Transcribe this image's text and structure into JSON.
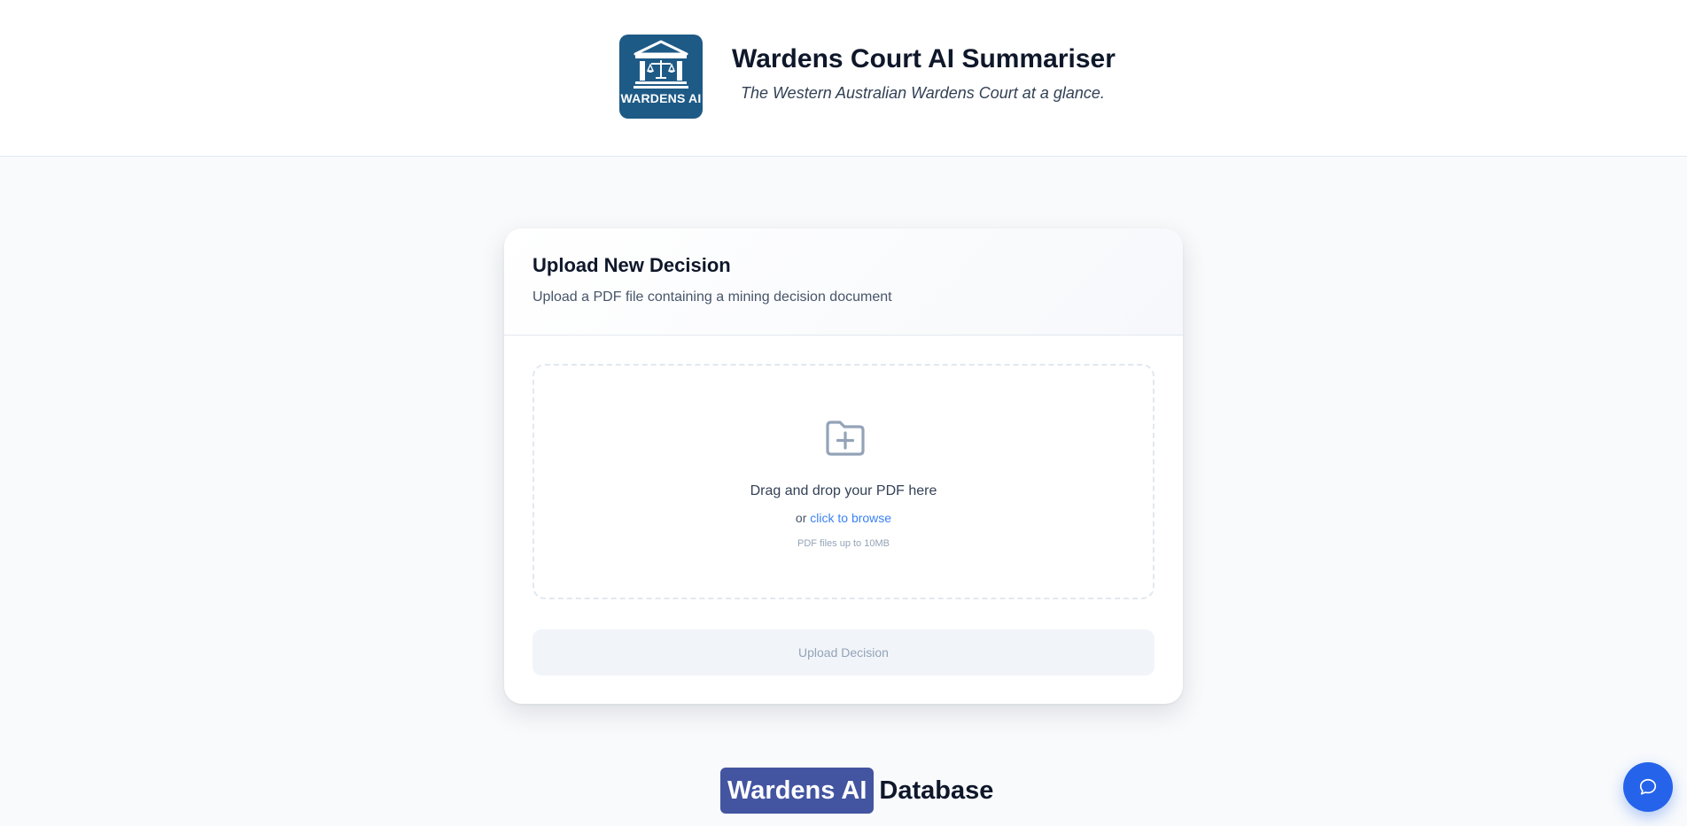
{
  "header": {
    "logo_text": "WARDENS AI",
    "title": "Wardens Court AI Summariser",
    "subtitle": "The Western Australian Wardens Court at a glance."
  },
  "upload_card": {
    "title": "Upload New Decision",
    "description": "Upload a PDF file containing a mining decision document",
    "dropzone": {
      "icon": "folder-plus-icon",
      "main_text": "Drag and drop your PDF here",
      "alt_prefix": "or",
      "browse_link": "click to browse",
      "hint": "PDF files up to 10MB"
    },
    "upload_button": "Upload Decision"
  },
  "database_heading": {
    "badge": "Wardens AI",
    "word": "Database"
  },
  "chat_button": {
    "icon": "chat-bubble-icon"
  },
  "colors": {
    "logo_bg": "#1e5a86",
    "badge_bg": "#4355a0",
    "link": "#3b82f6",
    "chat_bg": "#2563eb"
  }
}
